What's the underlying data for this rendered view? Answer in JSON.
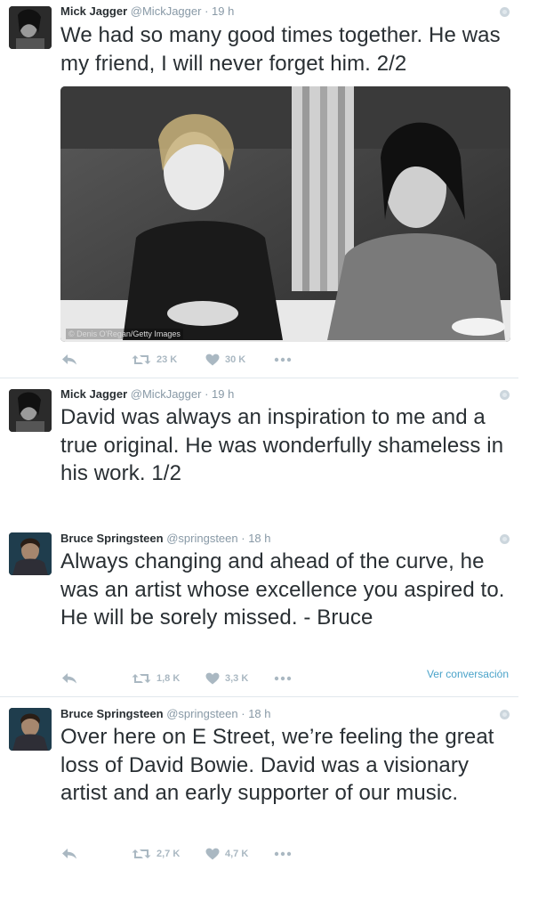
{
  "tweets": [
    {
      "name": "Mick Jagger",
      "handle": "@MickJagger",
      "time": "· 19 h",
      "text": "We had so many good times together. He was my friend, I will never forget him. 2/2",
      "photo_credit": "© Denis O'Regan/Getty Images",
      "retweets": "23 K",
      "likes": "30 K"
    },
    {
      "name": "Mick Jagger",
      "handle": "@MickJagger",
      "time": "· 19 h",
      "text": "David was always an inspiration to me and a true original. He was wonderfully shameless in his work. 1/2"
    },
    {
      "name": "Bruce Springsteen",
      "handle": "@springsteen",
      "time": "· 18 h",
      "text": "Always changing and ahead of the curve, he was an artist whose excellence you aspired to. He will be sorely missed. - Bruce",
      "retweets": "1,8 K",
      "likes": "3,3 K",
      "view_conversation": "Ver conversación"
    },
    {
      "name": "Bruce Springsteen",
      "handle": "@springsteen",
      "time": "· 18 h",
      "text": "Over here on E Street, we’re feeling the great loss of David Bowie. David was a visionary artist and an early supporter of our music.",
      "retweets": "2,7 K",
      "likes": "4,7 K"
    }
  ],
  "icons": {
    "reply": "reply-icon",
    "retweet": "retweet-icon",
    "like": "heart-icon",
    "more": "more-icon",
    "globe": "globe-icon"
  },
  "colors": {
    "text": "#292f33",
    "meta": "#8899a6",
    "action": "#aab8c2",
    "link": "#4aa3c9"
  }
}
